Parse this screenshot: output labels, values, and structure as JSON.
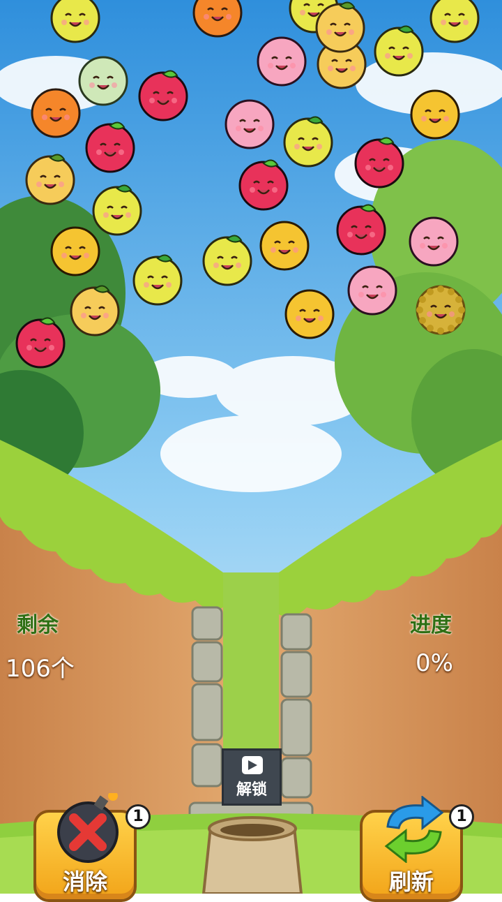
{
  "hud": {
    "remaining_label": "剩余",
    "remaining_value": "106个",
    "progress_label": "进度",
    "progress_value": "0%"
  },
  "controls": {
    "eliminate_label": "消除",
    "eliminate_count": "1",
    "refresh_label": "刷新",
    "refresh_count": "1",
    "unlock_label": "解锁"
  },
  "colors": {
    "sky": "#4aa6e6",
    "grass": "#9fd43a",
    "dirt": "#d9985b",
    "button": "#f7b52a",
    "hud_label": "#2f6f14"
  },
  "icons": {
    "eliminate": "bomb-x-icon",
    "refresh": "refresh-arrows-icon",
    "unlock": "video-play-icon",
    "sack": "sack-icon"
  },
  "fruits": [
    {
      "kind": "lemon"
    },
    {
      "kind": "orange"
    },
    {
      "kind": "lemon"
    },
    {
      "kind": "lemon"
    },
    {
      "kind": "melon"
    },
    {
      "kind": "peach"
    },
    {
      "kind": "pineapple"
    },
    {
      "kind": "lemon"
    },
    {
      "kind": "orange"
    },
    {
      "kind": "apple"
    },
    {
      "kind": "lemon"
    },
    {
      "kind": "mango"
    },
    {
      "kind": "apple"
    },
    {
      "kind": "pineapple"
    },
    {
      "kind": "peach"
    },
    {
      "kind": "apple"
    },
    {
      "kind": "apple"
    },
    {
      "kind": "pineapple"
    },
    {
      "kind": "lemon"
    },
    {
      "kind": "apple"
    },
    {
      "kind": "mango"
    },
    {
      "kind": "lemon"
    },
    {
      "kind": "lemon"
    },
    {
      "kind": "mango"
    },
    {
      "kind": "peach"
    },
    {
      "kind": "pineapple"
    },
    {
      "kind": "peach"
    },
    {
      "kind": "mango"
    },
    {
      "kind": "durian"
    },
    {
      "kind": "apple"
    }
  ]
}
